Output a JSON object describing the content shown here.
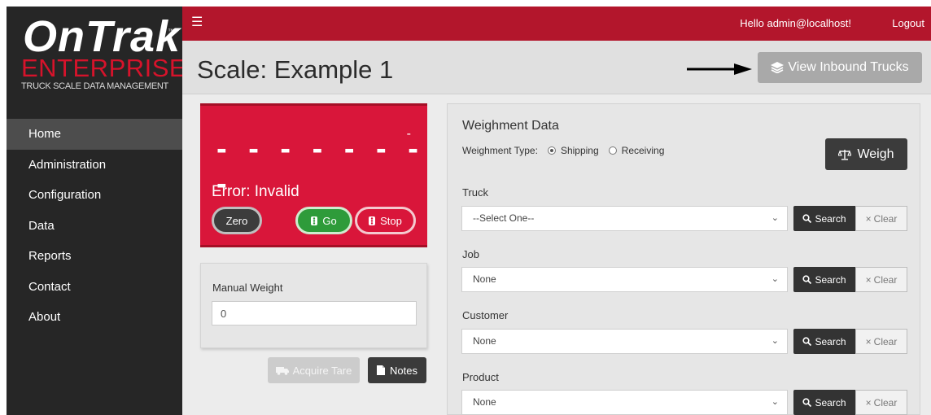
{
  "logo": {
    "word": "OnTrak",
    "tm": "™",
    "enterprise": "ENTERPRISE",
    "tagline": "TRUCK SCALE DATA MANAGEMENT"
  },
  "sidebar": {
    "items": [
      {
        "label": "Home",
        "active": true
      },
      {
        "label": "Administration"
      },
      {
        "label": "Configuration"
      },
      {
        "label": "Data"
      },
      {
        "label": "Reports"
      },
      {
        "label": "Contact"
      },
      {
        "label": "About"
      }
    ]
  },
  "topbar": {
    "menu_icon": "hamburger-icon",
    "greeting": "Hello admin@localhost!",
    "logout": "Logout"
  },
  "page": {
    "title": "Scale: Example 1",
    "view_trucks_label": "View Inbound Trucks",
    "view_trucks_icon": "layers-icon"
  },
  "scale": {
    "corner_mark": "-",
    "readout": "- - - - - - - -",
    "error": "Error: Invalid",
    "zero_label": "Zero",
    "go_label": "Go",
    "stop_label": "Stop"
  },
  "manual": {
    "label": "Manual Weight",
    "value": "0"
  },
  "actions": {
    "acquire_tare": "Acquire Tare",
    "notes": "Notes"
  },
  "weighment": {
    "title": "Weighment Data",
    "type_label": "Weighment Type:",
    "shipping": "Shipping",
    "receiving": "Receiving",
    "selected_type": "Shipping",
    "weigh_label": "Weigh",
    "fields": [
      {
        "label": "Truck",
        "value": "--Select One--"
      },
      {
        "label": "Job",
        "value": "None"
      },
      {
        "label": "Customer",
        "value": "None"
      },
      {
        "label": "Product",
        "value": "None"
      }
    ],
    "search_label": "Search",
    "clear_label": "Clear"
  },
  "colors": {
    "brand_red": "#b3162c",
    "scale_red": "#d9163a",
    "go_green": "#2e9b3a",
    "sidebar": "#262626"
  }
}
